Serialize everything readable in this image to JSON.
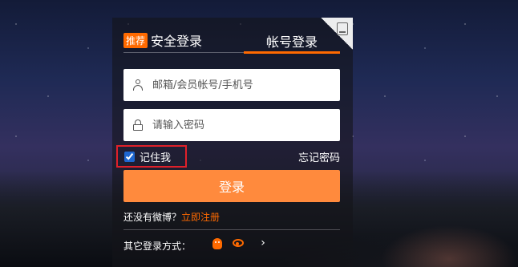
{
  "tabs": {
    "safe_badge": "推荐",
    "safe_label": "安全登录",
    "account_label": "帐号登录"
  },
  "form": {
    "username_placeholder": "邮箱/会员帐号/手机号",
    "password_placeholder": "请输入密码",
    "remember_label": "记住我",
    "forgot_label": "忘记密码",
    "login_label": "登录"
  },
  "register": {
    "prompt": "还没有微博？",
    "link": "立即注册"
  },
  "other_login": {
    "label": "其它登录方式：",
    "icons": [
      "qq-icon",
      "weibo-icon",
      "more-icon"
    ],
    "more_glyph": "›"
  },
  "colors": {
    "accent": "#ff6a00",
    "login_button": "#ff8a3d",
    "highlight_border": "#e0202a"
  }
}
